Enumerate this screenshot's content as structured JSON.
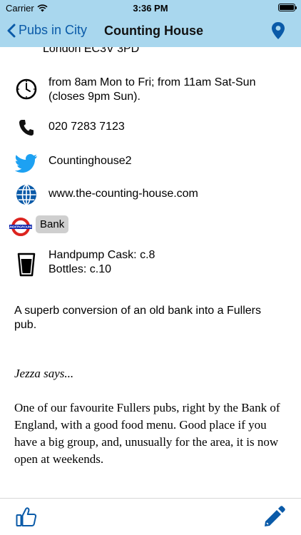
{
  "status_bar": {
    "carrier": "Carrier",
    "time": "3:36 PM"
  },
  "nav": {
    "back_label": "Pubs in City",
    "title": "Counting House",
    "map_icon": "map-pin-icon"
  },
  "address": {
    "line": "London EC3V 3PD"
  },
  "details": {
    "hours": "from 8am Mon to Fri; from 11am Sat-Sun (closes 9pm Sun).",
    "phone": "020 7283 7123",
    "twitter": "Countinghouse2",
    "website": "www.the-counting-house.com",
    "station": "Bank",
    "beer_cask": "Handpump Cask: c.8",
    "beer_bottles": "Bottles: c.10"
  },
  "description": "A superb conversion of an old bank into a Fullers pub.",
  "review": {
    "author_line": "Jezza says...",
    "text": "One of our favourite Fullers pubs, right by the Bank of England, with a good food menu. Good place if you have a big group, and, unusually for the area, it is now open at weekends."
  },
  "colors": {
    "header_bg": "#a9d7ee",
    "link_blue": "#0a5aa8",
    "twitter_blue": "#1da1f2",
    "underground_red": "#dc241f",
    "underground_blue": "#0019a8"
  }
}
